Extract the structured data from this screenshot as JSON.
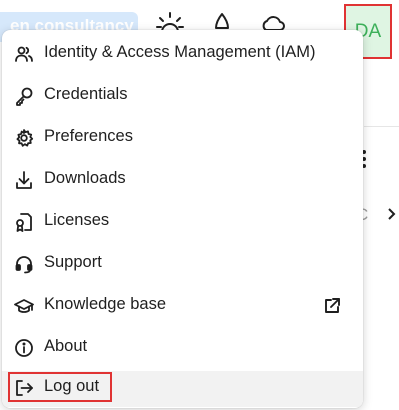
{
  "header": {
    "org_button": "en consultancy",
    "avatar_initials": "DA"
  },
  "background": {
    "truncated_text": "C"
  },
  "menu": {
    "items": [
      {
        "label": "Identity & Access Management (IAM)",
        "icon": "users-icon"
      },
      {
        "label": "Credentials",
        "icon": "key-icon"
      },
      {
        "label": "Preferences",
        "icon": "gear-icon"
      },
      {
        "label": "Downloads",
        "icon": "download-icon"
      },
      {
        "label": "Licenses",
        "icon": "license-icon"
      },
      {
        "label": "Support",
        "icon": "headset-icon"
      },
      {
        "label": "Knowledge base",
        "icon": "graduation-cap-icon",
        "trailing_icon": "external-link-icon"
      },
      {
        "label": "About",
        "icon": "info-icon"
      },
      {
        "label": "Log out",
        "icon": "logout-icon"
      }
    ]
  },
  "colors": {
    "highlight_border": "#e03333",
    "avatar_bg": "#dff5e3",
    "avatar_text": "#3db05a",
    "org_button_bg": "#d6e8fb",
    "hover_bg": "#f2f2f2"
  }
}
